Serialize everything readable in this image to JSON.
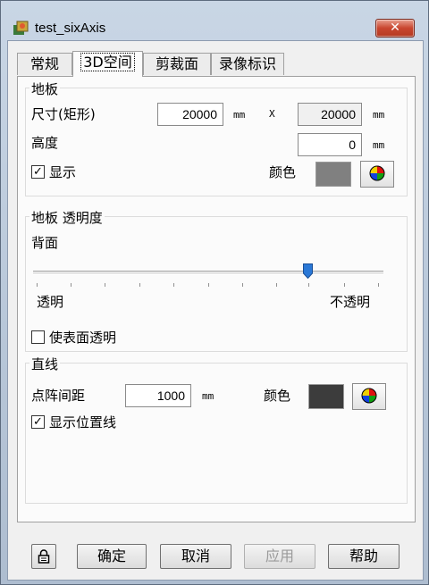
{
  "window": {
    "title": "test_sixAxis",
    "close_symbol": "✕"
  },
  "tabs": [
    {
      "label": "常规",
      "active": false
    },
    {
      "label": "3D空间",
      "active": true
    },
    {
      "label": "剪裁面",
      "active": false
    },
    {
      "label": "录像标识",
      "active": false
    }
  ],
  "floor": {
    "legend": "地板",
    "size_label": "尺寸(矩形)",
    "width_value": "20000",
    "unit": "mm",
    "times": "X",
    "depth_value": "20000",
    "height_label": "高度",
    "height_value": "0",
    "show_label": "显示",
    "show_checked": true,
    "color_label": "颜色",
    "color": "#808080"
  },
  "transparency": {
    "legend": "地板 透明度",
    "back_label": "背面",
    "slider_value_percent": 80,
    "min_label": "透明",
    "max_label": "不透明",
    "surface_label": "使表面透明",
    "surface_checked": false
  },
  "lines": {
    "legend": "直线",
    "spacing_label": "点阵间距",
    "spacing_value": "1000",
    "unit": "mm",
    "color_label": "颜色",
    "color": "#3c3c3c",
    "show_label": "显示位置线",
    "show_checked": true
  },
  "footer": {
    "ok": "确定",
    "cancel": "取消",
    "apply": "应用",
    "help": "帮助"
  },
  "icons": {
    "app": "app-icon",
    "lock": "lock-icon",
    "color_picker": "color-wheel-icon"
  }
}
